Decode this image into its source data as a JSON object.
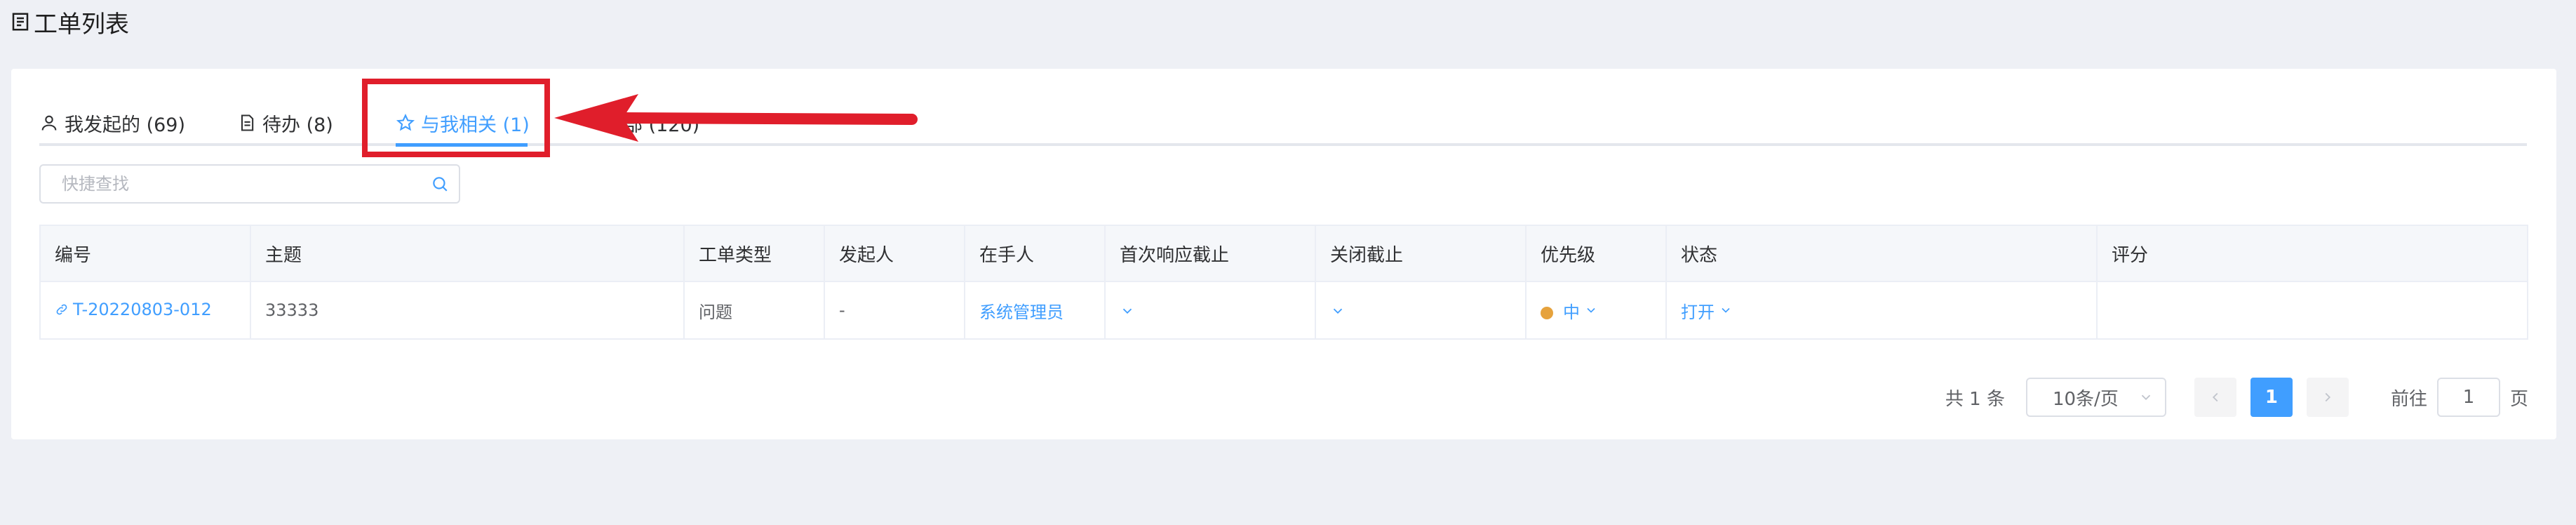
{
  "page": {
    "title": "工单列表"
  },
  "tabs": [
    {
      "label": "我发起的 (69)",
      "icon": "user-icon",
      "active": false
    },
    {
      "label": "待办 (8)",
      "icon": "document-icon",
      "active": false
    },
    {
      "label": "与我相关 (1)",
      "icon": "star-icon",
      "active": true
    },
    {
      "label": "全部 (120)",
      "icon": "",
      "active": false
    }
  ],
  "search": {
    "placeholder": "快捷查找",
    "value": ""
  },
  "table": {
    "columns": [
      "编号",
      "主题",
      "工单类型",
      "发起人",
      "在手人",
      "首次响应截止",
      "关闭截止",
      "优先级",
      "状态",
      "评分"
    ],
    "rows": [
      {
        "id": "T-20220803-012",
        "subject": "33333",
        "type": "问题",
        "initiator": "-",
        "handler": "系统管理员",
        "first_response_deadline": "",
        "close_deadline": "",
        "priority": "中",
        "status": "打开",
        "rating": ""
      }
    ]
  },
  "pagination": {
    "total_text": "共 1 条",
    "page_size": "10条/页",
    "current_page": "1",
    "goto_prefix": "前往",
    "goto_value": "1",
    "goto_suffix": "页"
  },
  "colors": {
    "accent": "#409eff",
    "annotation": "#e01e2b",
    "priority_medium": "#e6a23c"
  }
}
